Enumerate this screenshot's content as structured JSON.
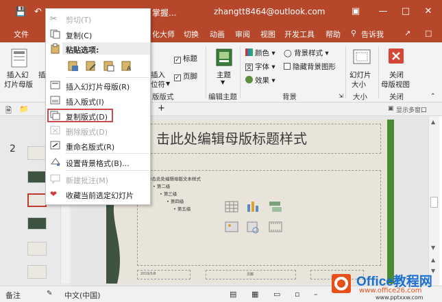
{
  "titlebar": {
    "title": "掌握...",
    "account": "zhangtt8464@outlook.com",
    "bg": "#b7472a"
  },
  "tabs": {
    "file": "文件",
    "slide_master_partial": "化大师",
    "transitions": "切换",
    "animations": "动画",
    "review": "审阅",
    "view": "视图",
    "developer": "开发工具",
    "help": "帮助",
    "tell_me": "告诉我"
  },
  "ribbon": {
    "insert_slide_master": "插入幻",
    "insert_slide_master_2": "灯片母版",
    "insert_layout_partial": "插",
    "insert_placeholder_1": "插入",
    "insert_placeholder_2": "位符",
    "title_check": "标题",
    "footer_check": "页脚",
    "master_layout_group": "版版式",
    "theme": "主题",
    "edit_theme_group": "编辑主题",
    "colors": "颜色",
    "fonts": "字体",
    "effects": "效果",
    "background_styles": "背景样式",
    "hide_bg_graphics": "隐藏背景图形",
    "background_group": "背景",
    "slide_size_1": "幻灯片",
    "slide_size_2": "大小",
    "size_group": "大小",
    "close_master_1": "关闭",
    "close_master_2": "母版视图",
    "close_group": "关闭",
    "show_multiple_windows": "显示多窗口"
  },
  "thumbnails": {
    "slide_number": "2"
  },
  "slide": {
    "title": "击此处编辑母版标题样式",
    "body_1": "单击此处编辑母版文本样式",
    "body_2": "第二级",
    "body_3": "第三级",
    "body_4": "第四级",
    "body_5": "第五级",
    "footer_date": "2019/5/8",
    "footer_center": "页脚",
    "accent_green": "#4a8a31"
  },
  "context_menu": {
    "cut": "剪切(T)",
    "copy": "复制(C)",
    "paste_options": "粘贴选项:",
    "insert_slide_master": "插入幻灯片母版(R)",
    "insert_layout": "插入版式(I)",
    "duplicate_layout": "复制版式(D)",
    "delete_layout": "删除版式(D)",
    "rename_layout": "重命名版式(R)",
    "format_background": "设置背景格式(B)...",
    "new_comment": "新建批注(M)",
    "favorite_slide": "收藏当前选定幻灯片",
    "highlight_color": "#d0474a"
  },
  "statusbar": {
    "notes": "备注",
    "language": "中文(中国)"
  },
  "watermark": {
    "brand": "Office教程网",
    "url": "www.office26.com",
    "url2": "www.pptxxw.com"
  }
}
